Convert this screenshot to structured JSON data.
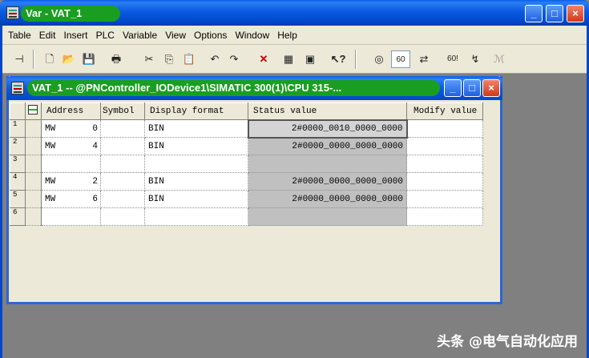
{
  "app": {
    "title": "Var - VAT_1",
    "caption_buttons": {
      "minimize": "_",
      "maximize": "□",
      "close": "×"
    }
  },
  "menu": [
    "Table",
    "Edit",
    "Insert",
    "PLC",
    "Variable",
    "View",
    "Options",
    "Window",
    "Help"
  ],
  "toolbar": {
    "icons": [
      {
        "name": "pin-icon",
        "glyph": "⊣"
      },
      {
        "name": "new-icon",
        "glyph": "🗋"
      },
      {
        "name": "open-icon",
        "glyph": "📂"
      },
      {
        "name": "save-icon",
        "glyph": "💾"
      },
      {
        "name": "print-icon",
        "glyph": "🖶"
      },
      {
        "name": "cut-icon",
        "glyph": "✂"
      },
      {
        "name": "copy-icon",
        "glyph": "⎘"
      },
      {
        "name": "paste-icon",
        "glyph": "📋"
      },
      {
        "name": "undo-icon",
        "glyph": "↶"
      },
      {
        "name": "redo-icon",
        "glyph": "↷"
      },
      {
        "name": "delete-icon",
        "glyph": "✕"
      },
      {
        "name": "network-icon",
        "glyph": "▦"
      },
      {
        "name": "accessible-nodes-icon",
        "glyph": "▣"
      },
      {
        "name": "help-pointer-icon",
        "glyph": "↖?"
      },
      {
        "name": "monitor-variable-icon",
        "glyph": "◎"
      },
      {
        "name": "monitor-once-icon",
        "glyph": "60"
      },
      {
        "name": "modify-variable-icon",
        "glyph": "⇄"
      },
      {
        "name": "update-monitor-icon",
        "glyph": "60!"
      },
      {
        "name": "activate-modify-icon",
        "glyph": "↯"
      },
      {
        "name": "force-icon",
        "glyph": "ℳ"
      }
    ]
  },
  "vat_window": {
    "title": "VAT_1 -- @PNController_IODevice1\\SIMATIC 300(1)\\CPU 315-..."
  },
  "table": {
    "columns": [
      "Address",
      "Symbol",
      "Display format",
      "Status value",
      "Modify value"
    ],
    "rows": [
      {
        "n": "1",
        "op": "MW",
        "num": "0",
        "symbol": "",
        "format": "BIN",
        "status": "2#0000_0010_0000_0000",
        "modify": ""
      },
      {
        "n": "2",
        "op": "MW",
        "num": "4",
        "symbol": "",
        "format": "BIN",
        "status": "2#0000_0000_0000_0000",
        "modify": ""
      },
      {
        "n": "3",
        "op": "",
        "num": "",
        "symbol": "",
        "format": "",
        "status": "",
        "modify": ""
      },
      {
        "n": "4",
        "op": "MW",
        "num": "2",
        "symbol": "",
        "format": "BIN",
        "status": "2#0000_0000_0000_0000",
        "modify": ""
      },
      {
        "n": "5",
        "op": "MW",
        "num": "6",
        "symbol": "",
        "format": "BIN",
        "status": "2#0000_0000_0000_0000",
        "modify": ""
      },
      {
        "n": "6",
        "op": "",
        "num": "",
        "symbol": "",
        "format": "",
        "status": "",
        "modify": ""
      }
    ]
  },
  "watermark": "头条 @电气自动化应用"
}
